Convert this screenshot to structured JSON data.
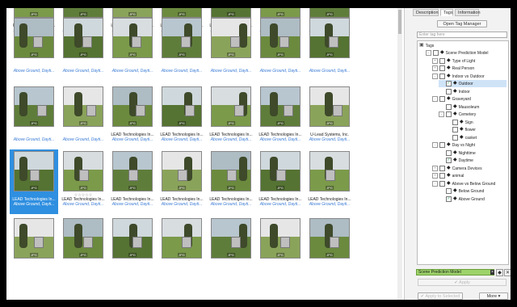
{
  "panel": {
    "tabs": [
      "Description",
      "Tags",
      "Information"
    ],
    "active_tab": "Tags",
    "open_tag_manager": "Open Tag Manager",
    "filter_placeholder": "Enter tag here",
    "tree_header": "Tags",
    "tree": [
      {
        "label": "Scene Prediction Model",
        "level": 1,
        "expand": "-",
        "checked": false
      },
      {
        "label": "Type of Light",
        "level": 2,
        "expand": "+",
        "checked": false
      },
      {
        "label": "Real Person",
        "level": 2,
        "expand": "+",
        "checked": false
      },
      {
        "label": "Indoor vs Outdoor",
        "level": 2,
        "expand": "-",
        "checked": false
      },
      {
        "label": "Outdoor",
        "level": 3,
        "expand": "",
        "checked": true,
        "selected": true
      },
      {
        "label": "Indoor",
        "level": 3,
        "expand": "",
        "checked": false
      },
      {
        "label": "Graveyard",
        "level": 2,
        "expand": "-",
        "checked": false
      },
      {
        "label": "Mausoleum",
        "level": 3,
        "expand": "",
        "checked": false
      },
      {
        "label": "Cemetery",
        "level": 3,
        "expand": "-",
        "checked": false
      },
      {
        "label": "Sign",
        "level": 4,
        "expand": "",
        "checked": false
      },
      {
        "label": "flower",
        "level": 4,
        "expand": "",
        "checked": false
      },
      {
        "label": "casket",
        "level": 4,
        "expand": "",
        "checked": false
      },
      {
        "label": "Day vs Night",
        "level": 2,
        "expand": "-",
        "checked": false
      },
      {
        "label": "Nighttime",
        "level": 3,
        "expand": "",
        "checked": false
      },
      {
        "label": "Daytime",
        "level": 3,
        "expand": "",
        "checked": true
      },
      {
        "label": "Camera Devices",
        "level": 2,
        "expand": "+",
        "checked": false
      },
      {
        "label": "animal",
        "level": 2,
        "expand": "+",
        "checked": false
      },
      {
        "label": "Above vs Below Ground",
        "level": 2,
        "expand": "-",
        "checked": false
      },
      {
        "label": "Below Ground",
        "level": 3,
        "expand": "",
        "checked": false
      },
      {
        "label": "Above Ground",
        "level": 3,
        "expand": "",
        "checked": true
      }
    ],
    "search_value": "Scene Prediction Model",
    "apply_label": "Apply",
    "apply_selected_label": "Apply to Selected",
    "more_label": "More"
  },
  "grid": {
    "rows": [
      {
        "cells": [
          {
            "caption": "File written by Adobe ...",
            "tags": "Above Ground, Dayti..."
          },
          {
            "caption": "binary comment",
            "tags": "Above Ground, Dayti..."
          },
          {
            "caption": "LEAD Technologies In...",
            "tags": "Above Ground, Dayti..."
          },
          {
            "caption": "LEAD Technologies In...",
            "tags": "Above Ground, Dayti..."
          },
          {
            "caption": "LEAD Technologies In...",
            "tags": "Above Ground, Dayti..."
          },
          {
            "caption": "",
            "tags": "Above Ground, Dayti..."
          },
          {
            "caption": "",
            "tags": "Above Ground, Dayti..."
          }
        ]
      },
      {
        "cells": [
          {
            "caption": "",
            "tags": "Above Ground, Dayti..."
          },
          {
            "caption": "",
            "tags": "Above Ground, Dayti..."
          },
          {
            "caption": "",
            "tags": "Above Ground, Dayti..."
          },
          {
            "caption": "",
            "tags": "Above Ground, Dayti..."
          },
          {
            "caption": "",
            "tags": "Above Ground, Dayti..."
          },
          {
            "caption": "",
            "tags": "Above Ground, Dayti..."
          },
          {
            "caption": "",
            "tags": "Above Ground, Dayti..."
          }
        ]
      },
      {
        "cells": [
          {
            "caption": "",
            "tags": "Above Ground, Dayti..."
          },
          {
            "caption": "",
            "tags": "Above Ground, Dayti..."
          },
          {
            "caption": "LEAD Technologies In...",
            "tags": "Above Ground, Dayti..."
          },
          {
            "caption": "LEAD Technologies In...",
            "tags": "Above Ground, Dayti..."
          },
          {
            "caption": "LEAD Technologies In...",
            "tags": "Above Ground, Dayti..."
          },
          {
            "caption": "LEAD Technologies In...",
            "tags": "Above Ground, Dayti..."
          },
          {
            "caption": "U-Lead Systems, Inc.",
            "tags": "Above Ground, Dayti..."
          }
        ]
      },
      {
        "cells": [
          {
            "caption": "LEAD Technologies In...",
            "tags": "Above Ground, Dayti...",
            "selected": true
          },
          {
            "caption": "LEAD Technologies In...",
            "tags": "Above Ground, Dayti...",
            "stars": "☆☆☆☆☆"
          },
          {
            "caption": "LEAD Technologies In...",
            "tags": "Above Ground, Dayti..."
          },
          {
            "caption": "LEAD Technologies In...",
            "tags": "Above Ground, Dayti..."
          },
          {
            "caption": "LEAD Technologies In...",
            "tags": "Above Ground, Dayti..."
          },
          {
            "caption": "LEAD Technologies In...",
            "tags": "Above Ground, Dayti..."
          },
          {
            "caption": "LEAD Technologies In...",
            "tags": "Above Ground, Dayti..."
          }
        ]
      },
      {
        "cells": [
          {
            "caption": "",
            "tags": ""
          },
          {
            "caption": "",
            "tags": ""
          },
          {
            "caption": "",
            "tags": ""
          },
          {
            "caption": "",
            "tags": ""
          },
          {
            "caption": "",
            "tags": ""
          },
          {
            "caption": "",
            "tags": ""
          },
          {
            "caption": "",
            "tags": ""
          }
        ]
      }
    ],
    "badge": "JPG"
  }
}
